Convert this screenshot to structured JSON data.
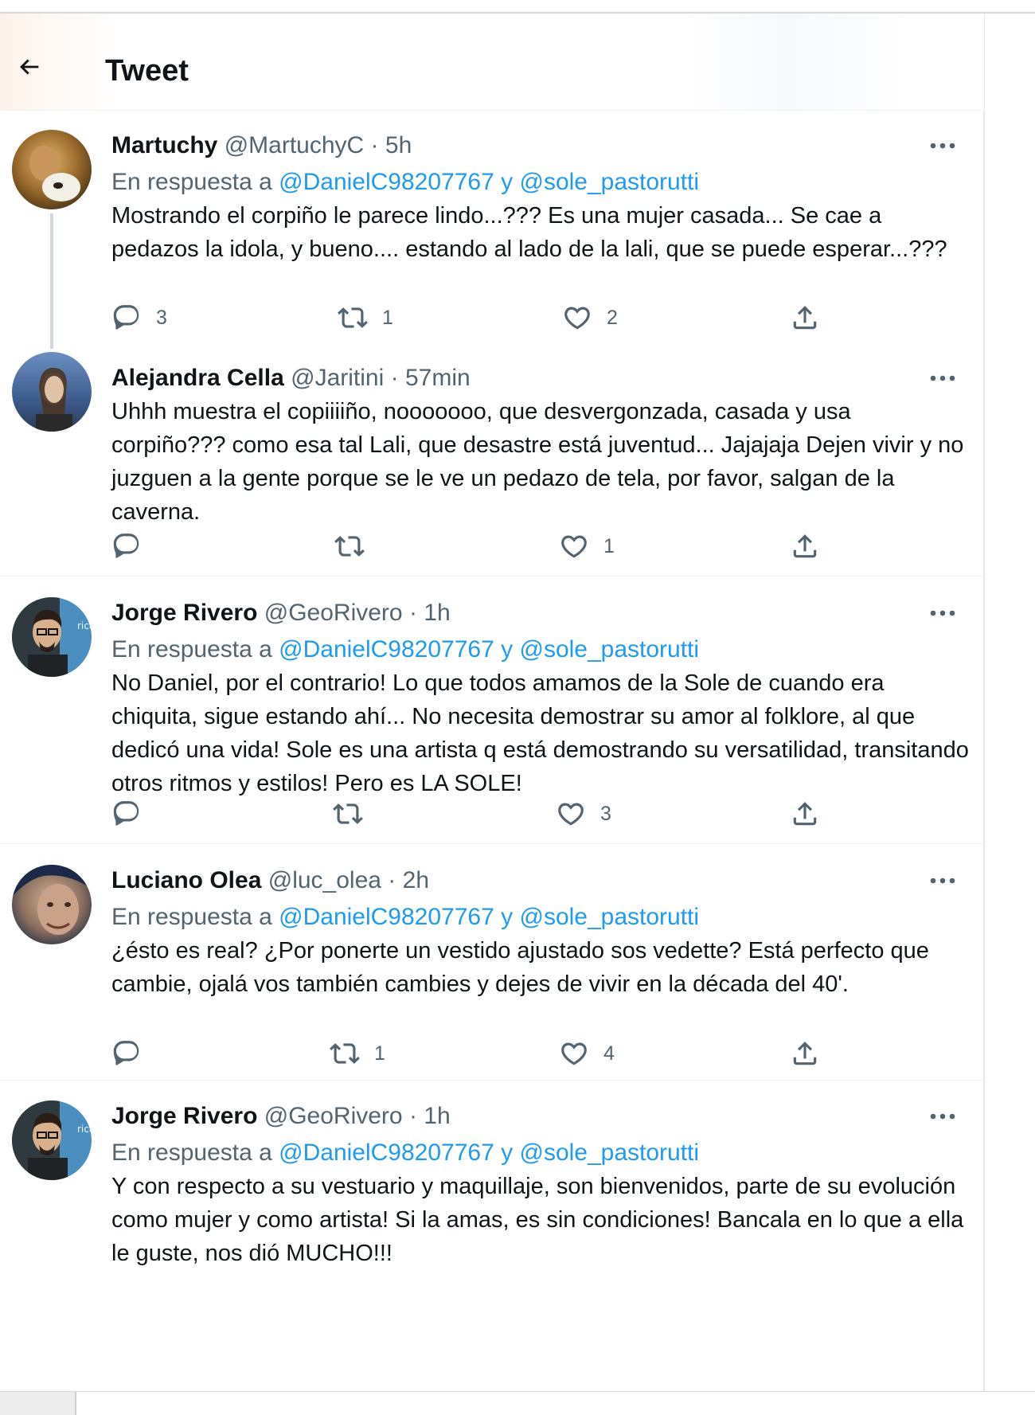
{
  "header": {
    "title": "Tweet"
  },
  "reply_prefix": "En respuesta a",
  "reply_joiner": "y",
  "tweets": [
    {
      "name": "Martuchy",
      "handle": "@MartuchyC",
      "sep": "·",
      "time": "5h",
      "reply_to": [
        "@DanielC98207767",
        "@sole_pastorutti"
      ],
      "text": "Mostrando el corpiño le parece lindo...??? Es una mujer casada... Se cae a pedazos la idola, y bueno.... estando al lado de la lali, que se puede esperar...???",
      "replies": "3",
      "retweets": "1",
      "likes": "2"
    },
    {
      "name": "Alejandra Cella",
      "handle": "@Jaritini",
      "sep": "·",
      "time": "57min",
      "reply_to": [],
      "text": "Uhhh muestra el copiiiiño,  nooooooo,  que desvergonzada, casada y usa corpiño??? como esa tal Lali,  que desastre está juventud... Jajajaja Dejen vivir y no juzguen a la gente porque se le ve un pedazo de tela,  por favor, salgan de la caverna.",
      "replies": "",
      "retweets": "",
      "likes": "1"
    },
    {
      "name": "Jorge Rivero",
      "handle": "@GeoRivero",
      "sep": "·",
      "time": "1h",
      "reply_to": [
        "@DanielC98207767",
        "@sole_pastorutti"
      ],
      "text": "No Daniel, por el contrario! Lo que todos amamos de la Sole de cuando era chiquita, sigue estando ahí... No necesita demostrar su amor al folklore, al que dedicó una vida! Sole es una artista q está demostrando su versatilidad, transitando otros ritmos y estilos! Pero es LA SOLE!",
      "replies": "",
      "retweets": "",
      "likes": "3"
    },
    {
      "name": "Luciano Olea",
      "handle": "@luc_olea",
      "sep": "·",
      "time": "2h",
      "reply_to": [
        "@DanielC98207767",
        "@sole_pastorutti"
      ],
      "text": "¿ésto es real? ¿Por ponerte un vestido ajustado sos vedette? Está perfecto que cambie, ojalá vos también cambies y dejes de vivir en la década del 40'.",
      "replies": "",
      "retweets": "1",
      "likes": "4"
    },
    {
      "name": "Jorge Rivero",
      "handle": "@GeoRivero",
      "sep": "·",
      "time": "1h",
      "reply_to": [
        "@DanielC98207767",
        "@sole_pastorutti"
      ],
      "text": "Y con respecto a su vestuario y maquillaje, son bienvenidos, parte de su evolución como mujer y como artista! Si la amas, es sin condiciones! Bancala en lo que a ella le guste, nos dió MUCHO!!!",
      "replies": "",
      "retweets": "",
      "likes": ""
    }
  ],
  "colors": {
    "accent": "#1d9bf0",
    "secondary_text": "#536471",
    "text": "#0f1419",
    "divider": "#eff3f4"
  },
  "icons": [
    "back-arrow-icon",
    "more-icon",
    "reply-icon",
    "retweet-icon",
    "like-icon",
    "share-icon"
  ]
}
